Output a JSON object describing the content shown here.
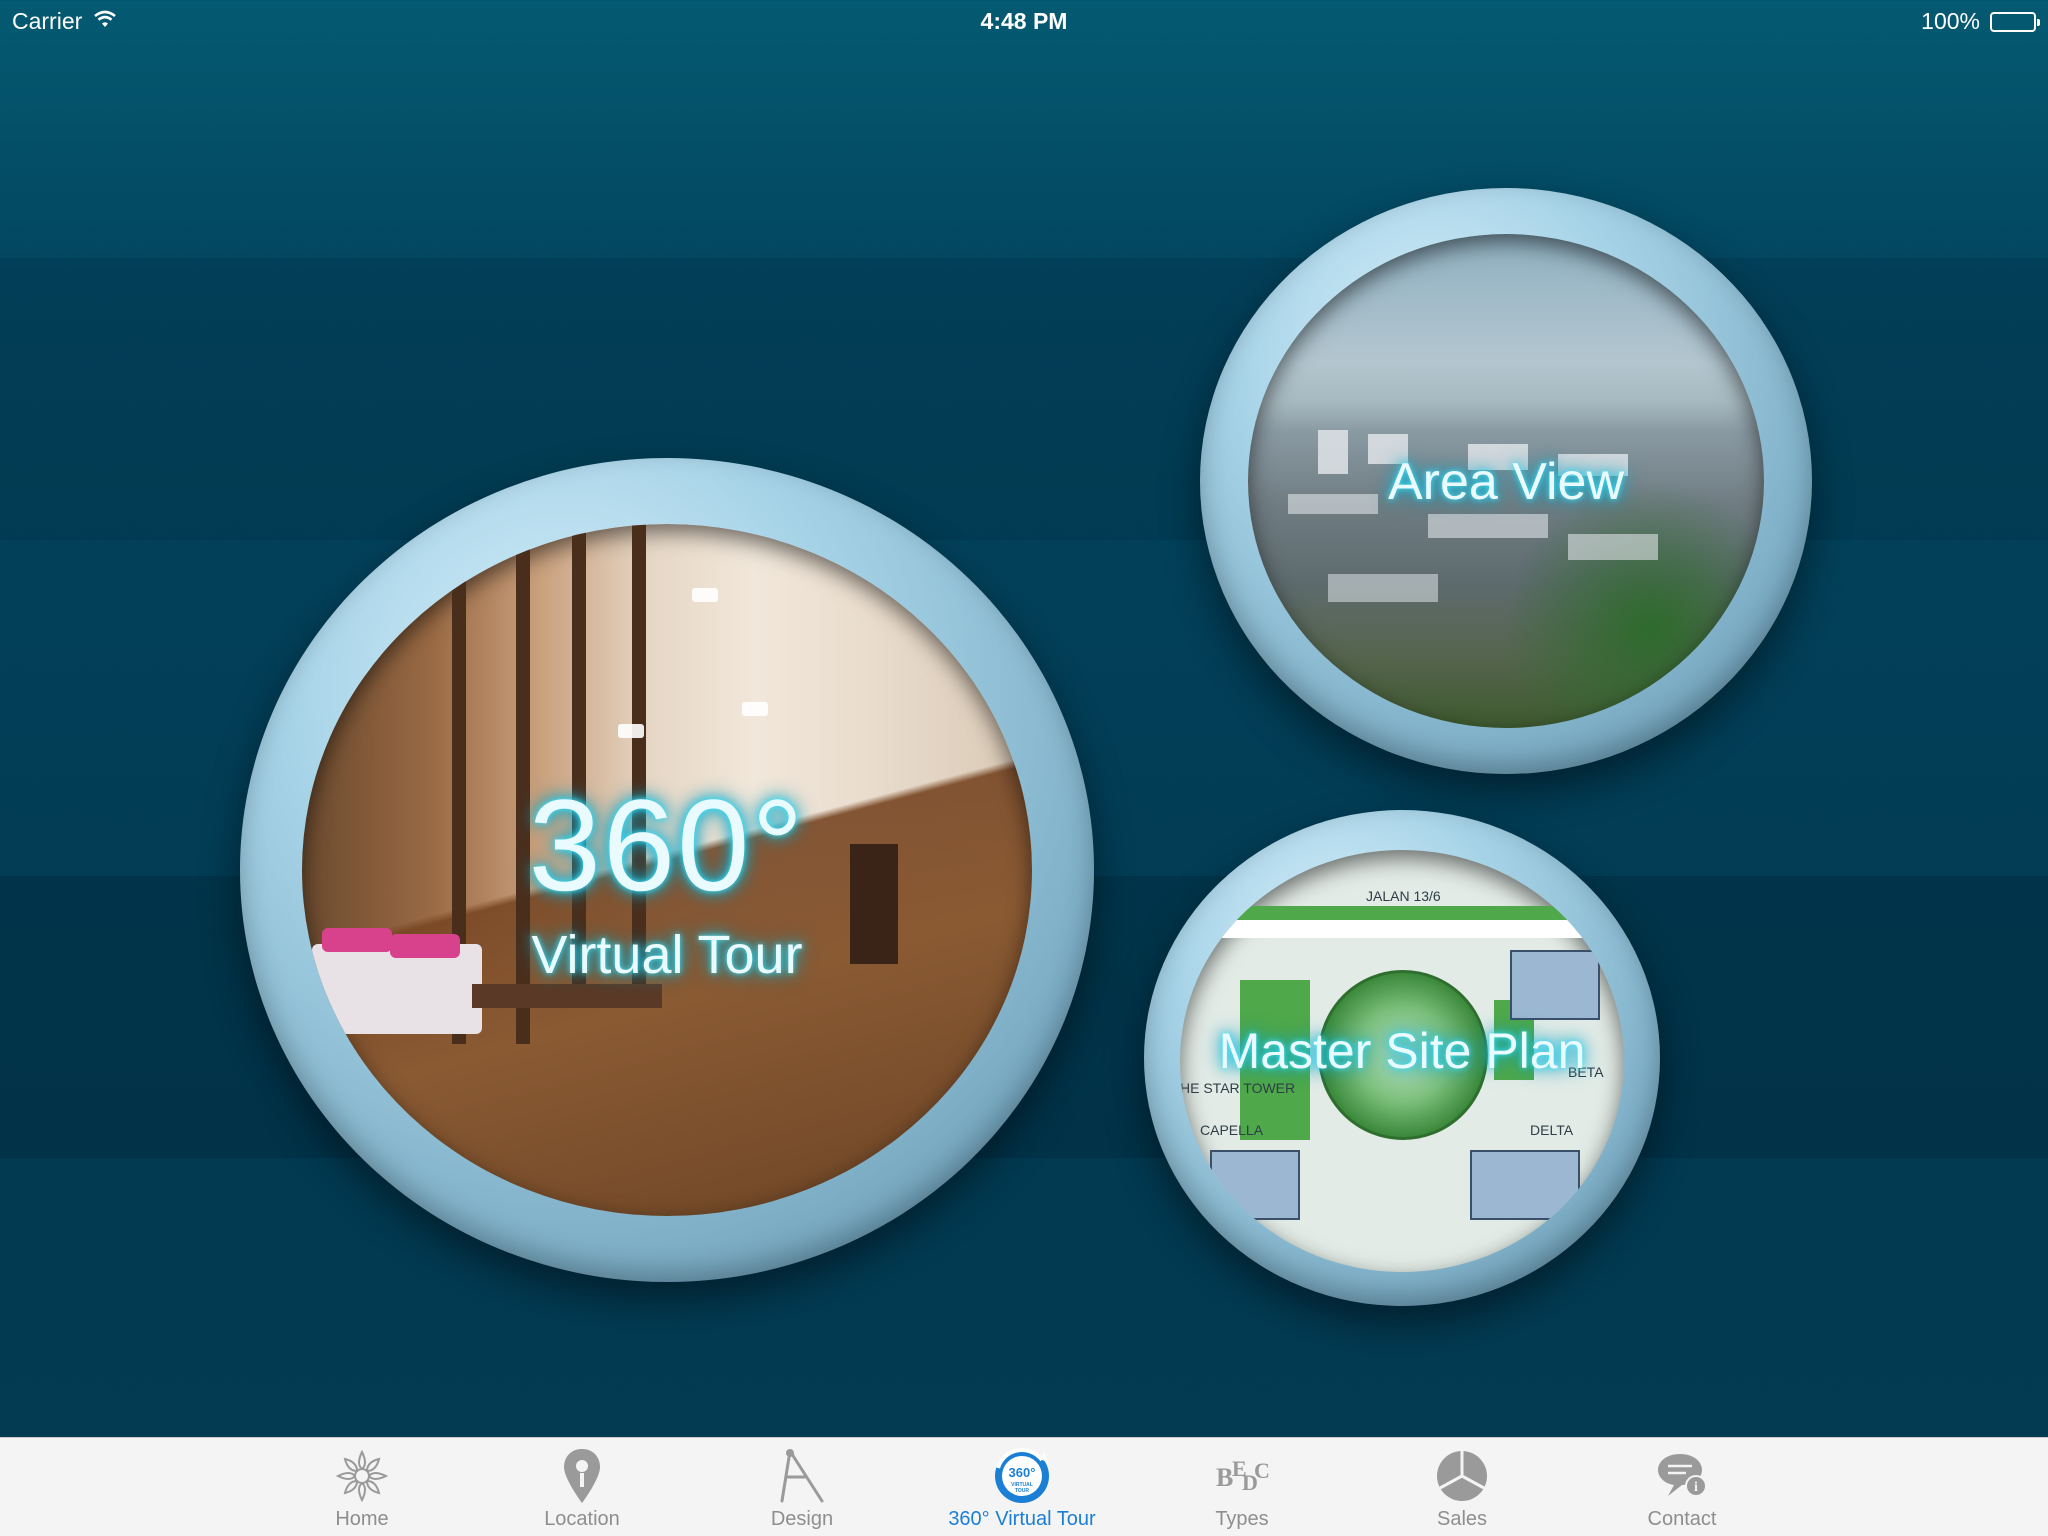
{
  "status_bar": {
    "carrier": "Carrier",
    "time": "4:48 PM",
    "battery_percent": "100%"
  },
  "tiles": {
    "tour": {
      "line1": "360°",
      "line2": "Virtual Tour"
    },
    "area": {
      "label": "Area View"
    },
    "site": {
      "label": "Master Site Plan",
      "map_labels": [
        "JALAN 13/6",
        "HE STAR TOWER",
        "BETA",
        "CAPELLA",
        "DELTA"
      ]
    }
  },
  "tab_bar": {
    "active_color": "#1b7fd6",
    "inactive_color": "#8e8e8e",
    "items": [
      {
        "label": "Home",
        "icon": "flower-icon",
        "active": false
      },
      {
        "label": "Location",
        "icon": "map-pin-icon",
        "active": false
      },
      {
        "label": "Design",
        "icon": "compass-drafting-icon",
        "active": false
      },
      {
        "label": "360° Virtual Tour",
        "icon": "virtual-tour-360-icon",
        "active": true
      },
      {
        "label": "Types",
        "icon": "types-icon",
        "active": false
      },
      {
        "label": "Sales",
        "icon": "pie-chart-icon",
        "active": false
      },
      {
        "label": "Contact",
        "icon": "speech-bubble-info-icon",
        "active": false
      }
    ]
  }
}
